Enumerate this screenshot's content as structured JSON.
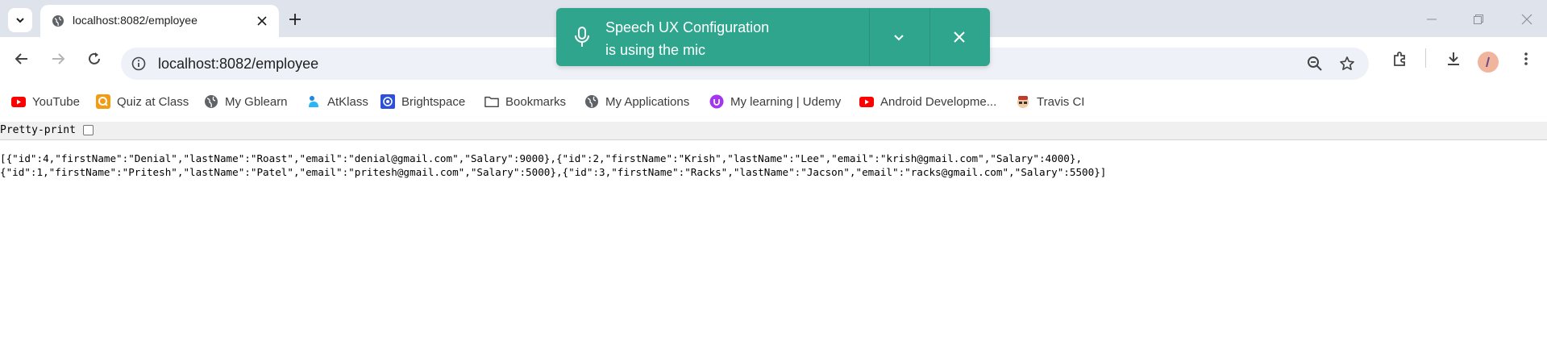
{
  "browser": {
    "tab": {
      "title": "localhost:8082/employee"
    },
    "address_bar": {
      "url": "localhost:8082/employee"
    }
  },
  "bookmarks": [
    {
      "label": "YouTube",
      "icon": "youtube-icon"
    },
    {
      "label": "Quiz at Class",
      "icon": "quiz-icon"
    },
    {
      "label": "My Gblearn",
      "icon": "globe-icon"
    },
    {
      "label": "AtKlass",
      "icon": "atklass-icon"
    },
    {
      "label": "Brightspace",
      "icon": "brightspace-icon"
    },
    {
      "label": "Bookmarks",
      "icon": "folder-icon"
    },
    {
      "label": "My Applications",
      "icon": "globe-icon"
    },
    {
      "label": "My learning | Udemy",
      "icon": "udemy-icon"
    },
    {
      "label": "Android Developme...",
      "icon": "youtube-icon"
    },
    {
      "label": "Travis CI",
      "icon": "travis-icon"
    }
  ],
  "notification": {
    "line1": "Speech UX Configuration",
    "line2": "is using the mic",
    "color": "#30a58e"
  },
  "page": {
    "pretty_print_label": "Pretty-print",
    "pretty_print_checked": false,
    "json_line1": "[{\"id\":4,\"firstName\":\"Denial\",\"lastName\":\"Roast\",\"email\":\"denial@gmail.com\",\"Salary\":9000},{\"id\":2,\"firstName\":\"Krish\",\"lastName\":\"Lee\",\"email\":\"krish@gmail.com\",\"Salary\":4000},",
    "json_line2": "{\"id\":1,\"firstName\":\"Pritesh\",\"lastName\":\"Patel\",\"email\":\"pritesh@gmail.com\",\"Salary\":5000},{\"id\":3,\"firstName\":\"Racks\",\"lastName\":\"Jacson\",\"email\":\"racks@gmail.com\",\"Salary\":5500}]"
  },
  "colors": {
    "tabstrip": "#dfe3eb",
    "omnibox": "#eef1f7",
    "toast": "#30a58e"
  }
}
